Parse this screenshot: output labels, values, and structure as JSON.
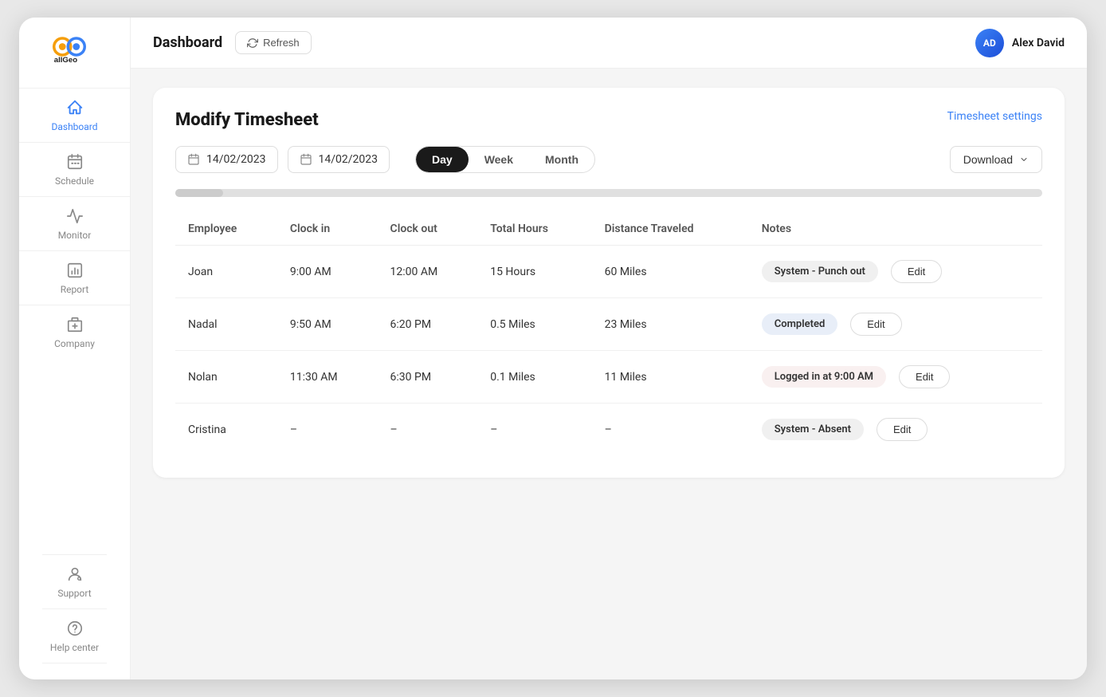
{
  "app": {
    "name": "allGeo"
  },
  "header": {
    "title": "Dashboard",
    "refresh_label": "Refresh",
    "user": {
      "name": "Alex David",
      "initials": "AD"
    }
  },
  "sidebar": {
    "items": [
      {
        "id": "dashboard",
        "label": "Dashboard",
        "active": true
      },
      {
        "id": "schedule",
        "label": "Schedule",
        "active": false
      },
      {
        "id": "monitor",
        "label": "Monitor",
        "active": false
      },
      {
        "id": "report",
        "label": "Report",
        "active": false
      },
      {
        "id": "company",
        "label": "Company",
        "active": false
      },
      {
        "id": "support",
        "label": "Support",
        "active": false
      },
      {
        "id": "help",
        "label": "Help center",
        "active": false
      }
    ]
  },
  "page": {
    "title": "Modify Timesheet",
    "settings_link": "Timesheet settings",
    "date_from": "14/02/2023",
    "date_to": "14/02/2023",
    "period_options": [
      "Day",
      "Week",
      "Month"
    ],
    "active_period": "Day",
    "download_label": "Download"
  },
  "table": {
    "columns": [
      "Employee",
      "Clock in",
      "Clock out",
      "Total Hours",
      "Distance Traveled",
      "Notes"
    ],
    "rows": [
      {
        "employee": "Joan",
        "clock_in": "9:00 AM",
        "clock_out": "12:00 AM",
        "total_hours": "15 Hours",
        "distance": "60 Miles",
        "note": "System - Punch out",
        "note_type": "system-punch",
        "edit_label": "Edit"
      },
      {
        "employee": "Nadal",
        "clock_in": "9:50 AM",
        "clock_out": "6:20 PM",
        "total_hours": "0.5 Miles",
        "distance": "23 Miles",
        "note": "Completed",
        "note_type": "completed",
        "edit_label": "Edit"
      },
      {
        "employee": "Nolan",
        "clock_in": "11:30 AM",
        "clock_out": "6:30 PM",
        "total_hours": "0.1 Miles",
        "distance": "11 Miles",
        "note": "Logged in at 9:00 AM",
        "note_type": "logged-in",
        "edit_label": "Edit"
      },
      {
        "employee": "Cristina",
        "clock_in": "–",
        "clock_out": "–",
        "total_hours": "–",
        "distance": "–",
        "note": "System - Absent",
        "note_type": "absent",
        "edit_label": "Edit"
      }
    ]
  }
}
